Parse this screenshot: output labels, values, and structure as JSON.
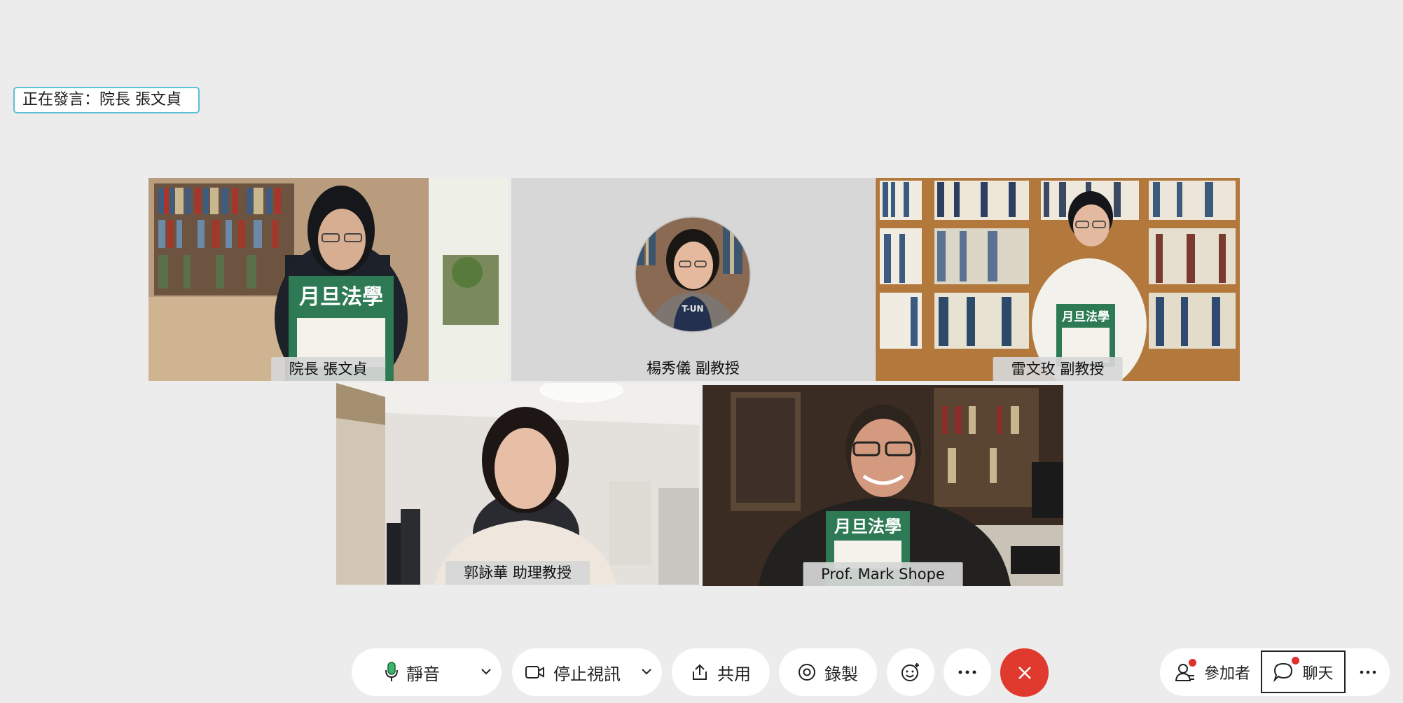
{
  "speaker": {
    "prefix": "正在發言：",
    "name": "院長 張文貞"
  },
  "participants": [
    {
      "name": "院長 張文貞",
      "active": true
    },
    {
      "name": "楊秀儀 副教授",
      "video": false
    },
    {
      "name": "雷文玫 副教授"
    },
    {
      "name": "郭詠華 助理教授"
    },
    {
      "name": "Prof. Mark Shope"
    }
  ],
  "toolbar": {
    "mute": "靜音",
    "stop_video": "停止視訊",
    "share": "共用",
    "record": "錄製",
    "participants": "參加者",
    "chat": "聊天"
  },
  "book": {
    "title": "月旦法學"
  },
  "colors": {
    "accent": "#1fb5e3",
    "end": "#e0392e",
    "badge": "#e0302b"
  },
  "icons": [
    "mic-icon",
    "chevron-down-icon",
    "video-icon",
    "share-icon",
    "record-icon",
    "reaction-icon",
    "more-icon",
    "close-icon",
    "participants-icon",
    "chat-icon"
  ]
}
